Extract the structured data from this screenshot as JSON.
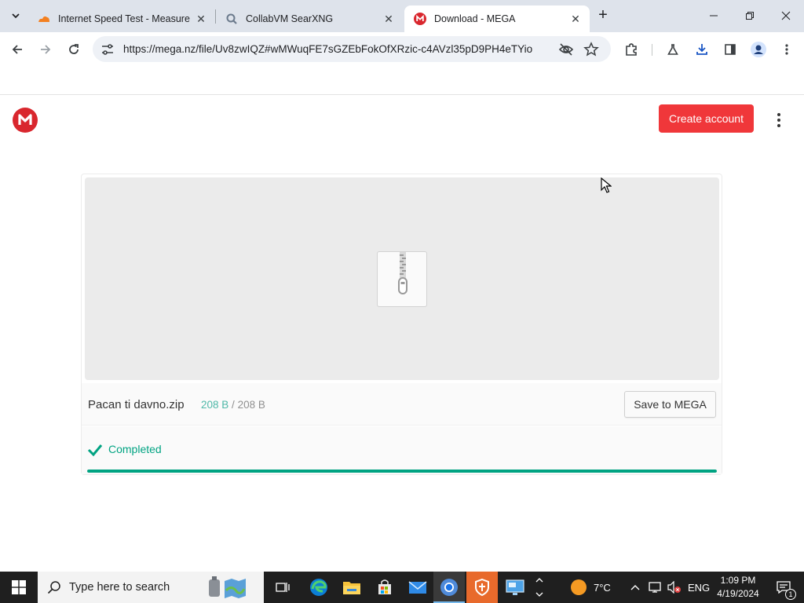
{
  "browser": {
    "tabs": [
      {
        "title": "Internet Speed Test - Measure",
        "favicon": "cloudflare-icon",
        "active": false
      },
      {
        "title": "CollabVM SearXNG",
        "favicon": "searxng-icon",
        "active": false
      },
      {
        "title": "Download - MEGA",
        "favicon": "mega-icon",
        "active": true
      }
    ],
    "tab_close_glyph": "✕",
    "new_tab_glyph": "+",
    "url": "https://mega.nz/file/Uv8zwIQZ#wMWuqFE7sGZEbFokOfXRzic-c4AVzl35pD9PH4eTYio"
  },
  "page": {
    "brand_color": "#d9272e",
    "create_account_label": "Create account",
    "file": {
      "name": "Pacan ti davno.zip",
      "downloaded": "208 B",
      "separator": "/",
      "total": "208 B"
    },
    "save_button_label": "Save to MEGA",
    "status": "Completed",
    "progress_percent": 100,
    "accent_color": "#00a382"
  },
  "taskbar": {
    "search_placeholder": "Type here to search",
    "weather_temp": "7°C",
    "language": "ENG",
    "time": "1:09 PM",
    "date": "4/19/2024",
    "notification_count": "1"
  }
}
